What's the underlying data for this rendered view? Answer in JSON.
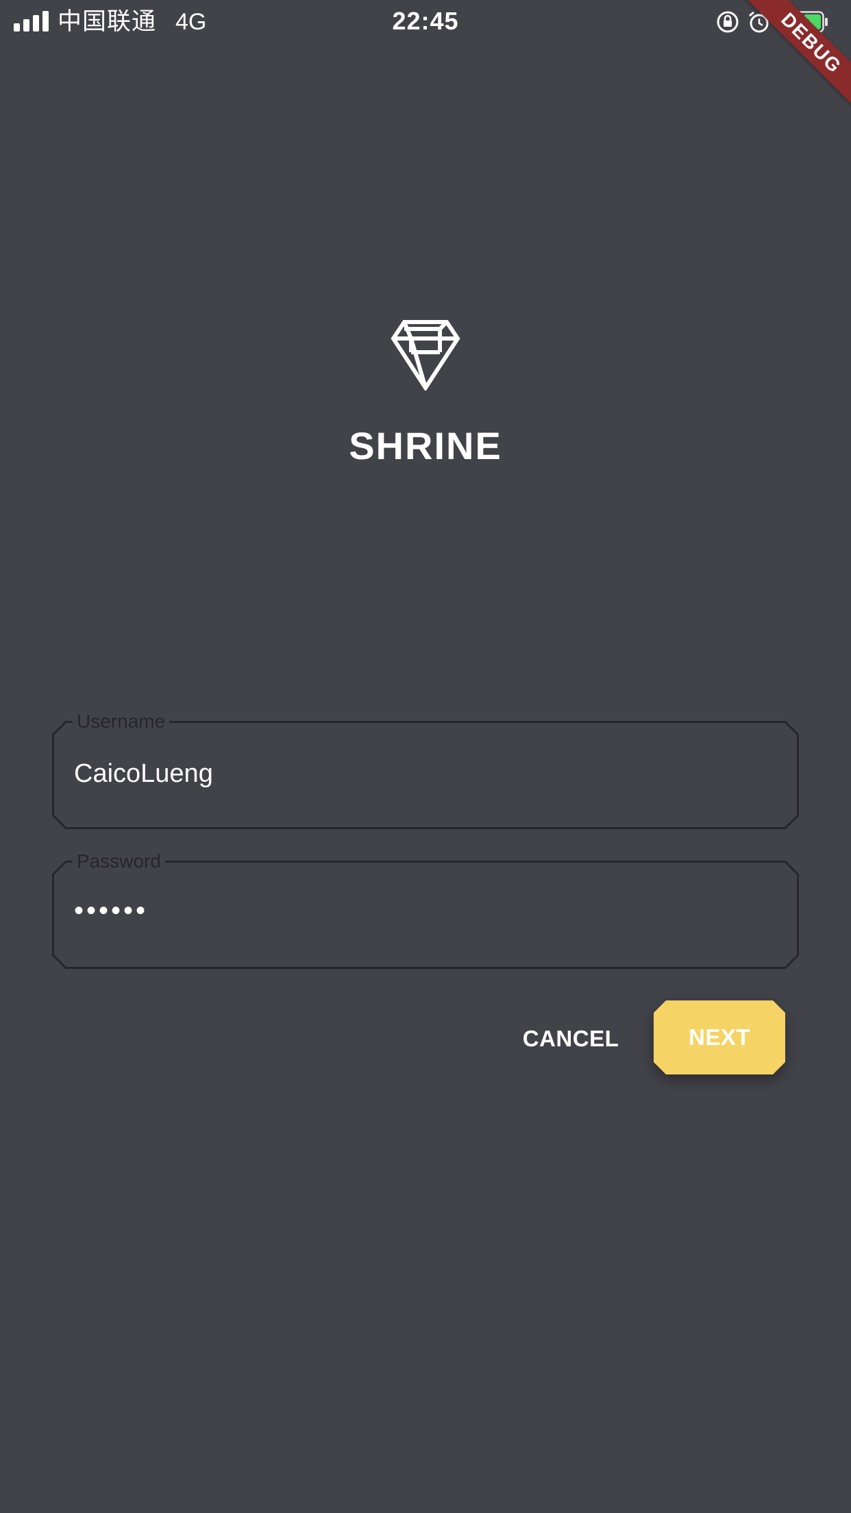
{
  "status_bar": {
    "carrier": "中国联通",
    "network": "4G",
    "time": "22:45",
    "icons": [
      "signal-icon",
      "rotation-lock-icon",
      "alarm-icon",
      "battery-charging-icon"
    ]
  },
  "debug_ribbon": "DEBUG",
  "branding": {
    "logo_icon": "diamond-icon",
    "title": "SHRINE"
  },
  "form": {
    "username": {
      "label": "Username",
      "value": "CaicoLueng"
    },
    "password": {
      "label": "Password",
      "value": "••••••"
    }
  },
  "actions": {
    "cancel_label": "CANCEL",
    "next_label": "NEXT"
  },
  "colors": {
    "background": "#424249",
    "accent": "#f6d365",
    "field_border": "#26262b",
    "ribbon": "#8b2a2b",
    "battery_fill": "#4cd964"
  }
}
